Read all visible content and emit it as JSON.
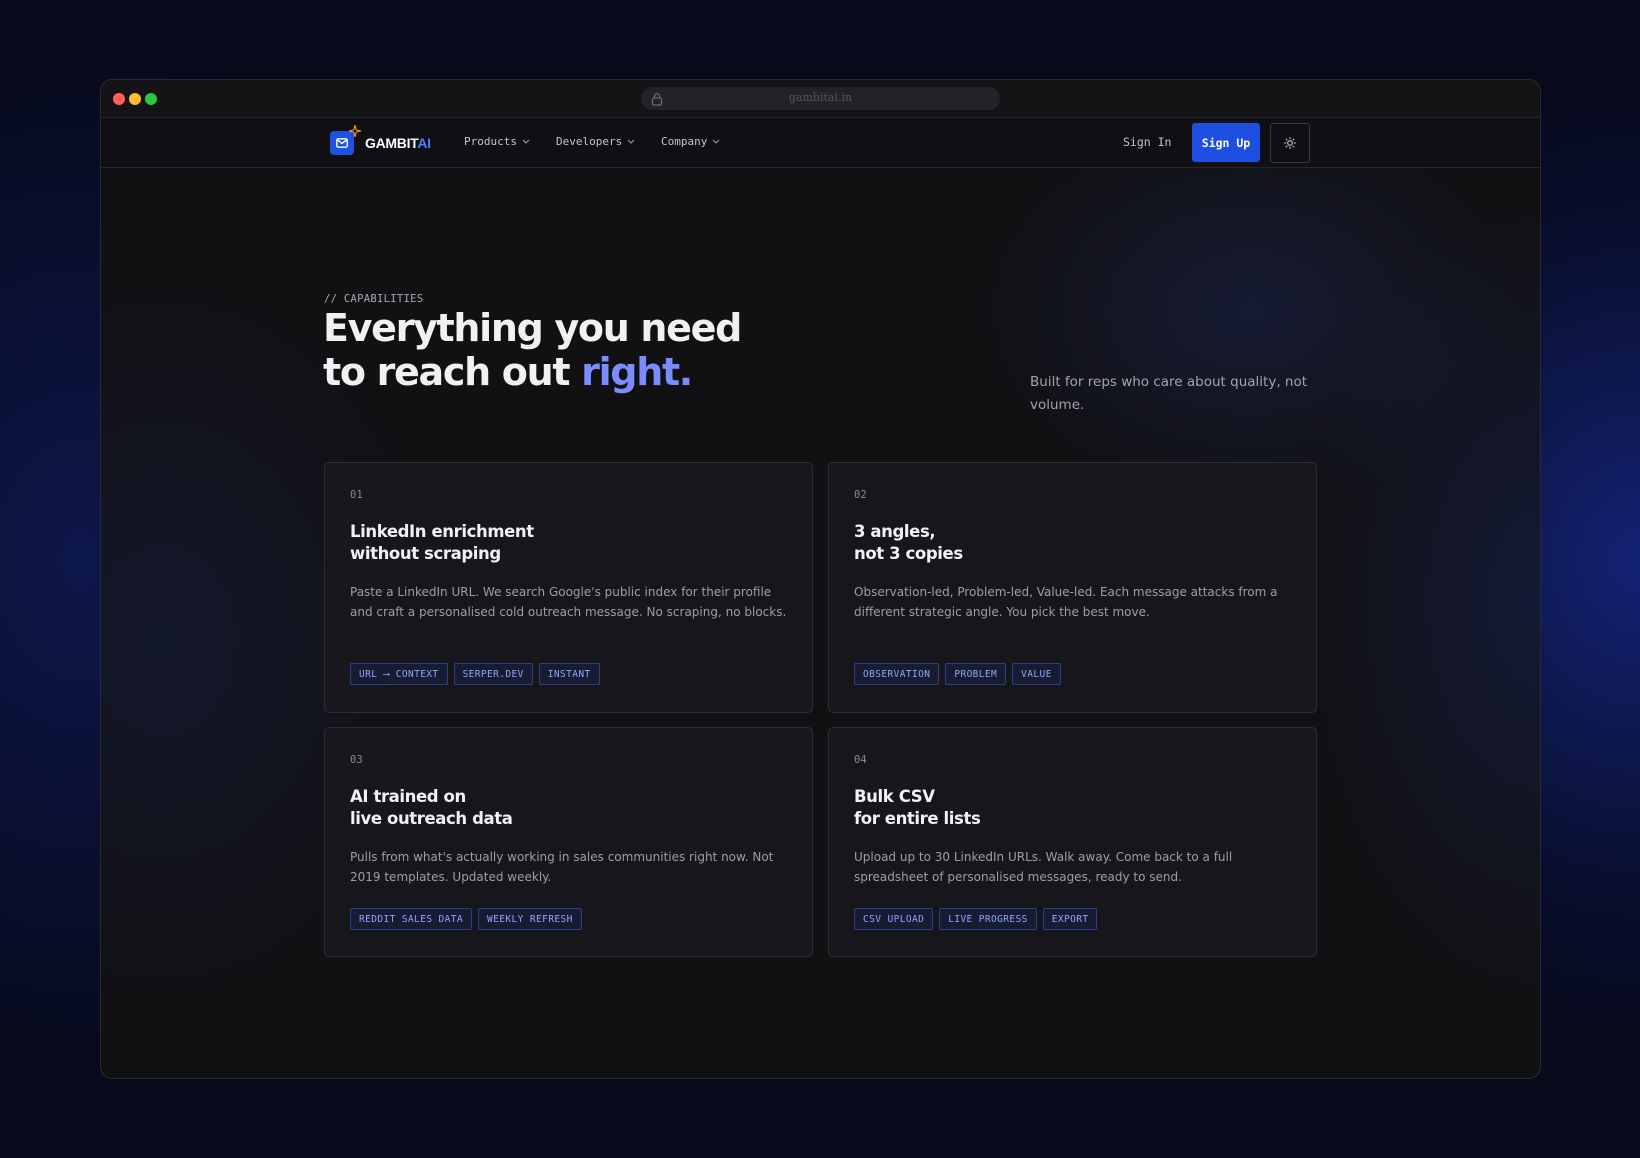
{
  "browser": {
    "url": "gambitai.in"
  },
  "nav": {
    "logo_main": "GAMBIT",
    "logo_accent": "AI",
    "items": [
      {
        "label": "Products"
      },
      {
        "label": "Developers"
      },
      {
        "label": "Company"
      }
    ],
    "sign_in": "Sign In",
    "sign_up": "Sign Up",
    "theme_icon": "sun-icon"
  },
  "hero": {
    "eyebrow": "// CAPABILITIES",
    "headline_line1": "Everything you need",
    "headline_line2_prefix": "to reach out ",
    "headline_accent": "right.",
    "subtext": "Built for reps who care about quality, not volume."
  },
  "cards": [
    {
      "number": "01",
      "title_line1": "LinkedIn enrichment",
      "title_line2": "without scraping",
      "description": "Paste a LinkedIn URL. We search Google's public index for their profile and craft a personalised cold outreach message. No scraping, no blocks.",
      "tags": [
        "URL ⟶ CONTEXT",
        "SERPER.DEV",
        "INSTANT"
      ]
    },
    {
      "number": "02",
      "title_line1": "3 angles,",
      "title_line2": "not 3 copies",
      "description": "Observation-led, Problem-led, Value-led. Each message attacks from a different strategic angle. You pick the best move.",
      "tags": [
        "OBSERVATION",
        "PROBLEM",
        "VALUE"
      ]
    },
    {
      "number": "03",
      "title_line1": "AI trained on",
      "title_line2": "live outreach data",
      "description": "Pulls from what's actually working in sales communities right now. Not 2019 templates. Updated weekly.",
      "tags": [
        "REDDIT SALES DATA",
        "WEEKLY REFRESH"
      ]
    },
    {
      "number": "04",
      "title_line1": "Bulk CSV",
      "title_line2": "for entire lists",
      "description": "Upload up to 30 LinkedIn URLs. Walk away. Come back to a full spreadsheet of personalised messages, ready to send.",
      "tags": [
        "CSV UPLOAD",
        "LIVE PROGRESS",
        "EXPORT"
      ]
    }
  ],
  "colors": {
    "accent": "#7b8cff",
    "brand_blue": "#1e4ee0",
    "background": "#111114"
  }
}
